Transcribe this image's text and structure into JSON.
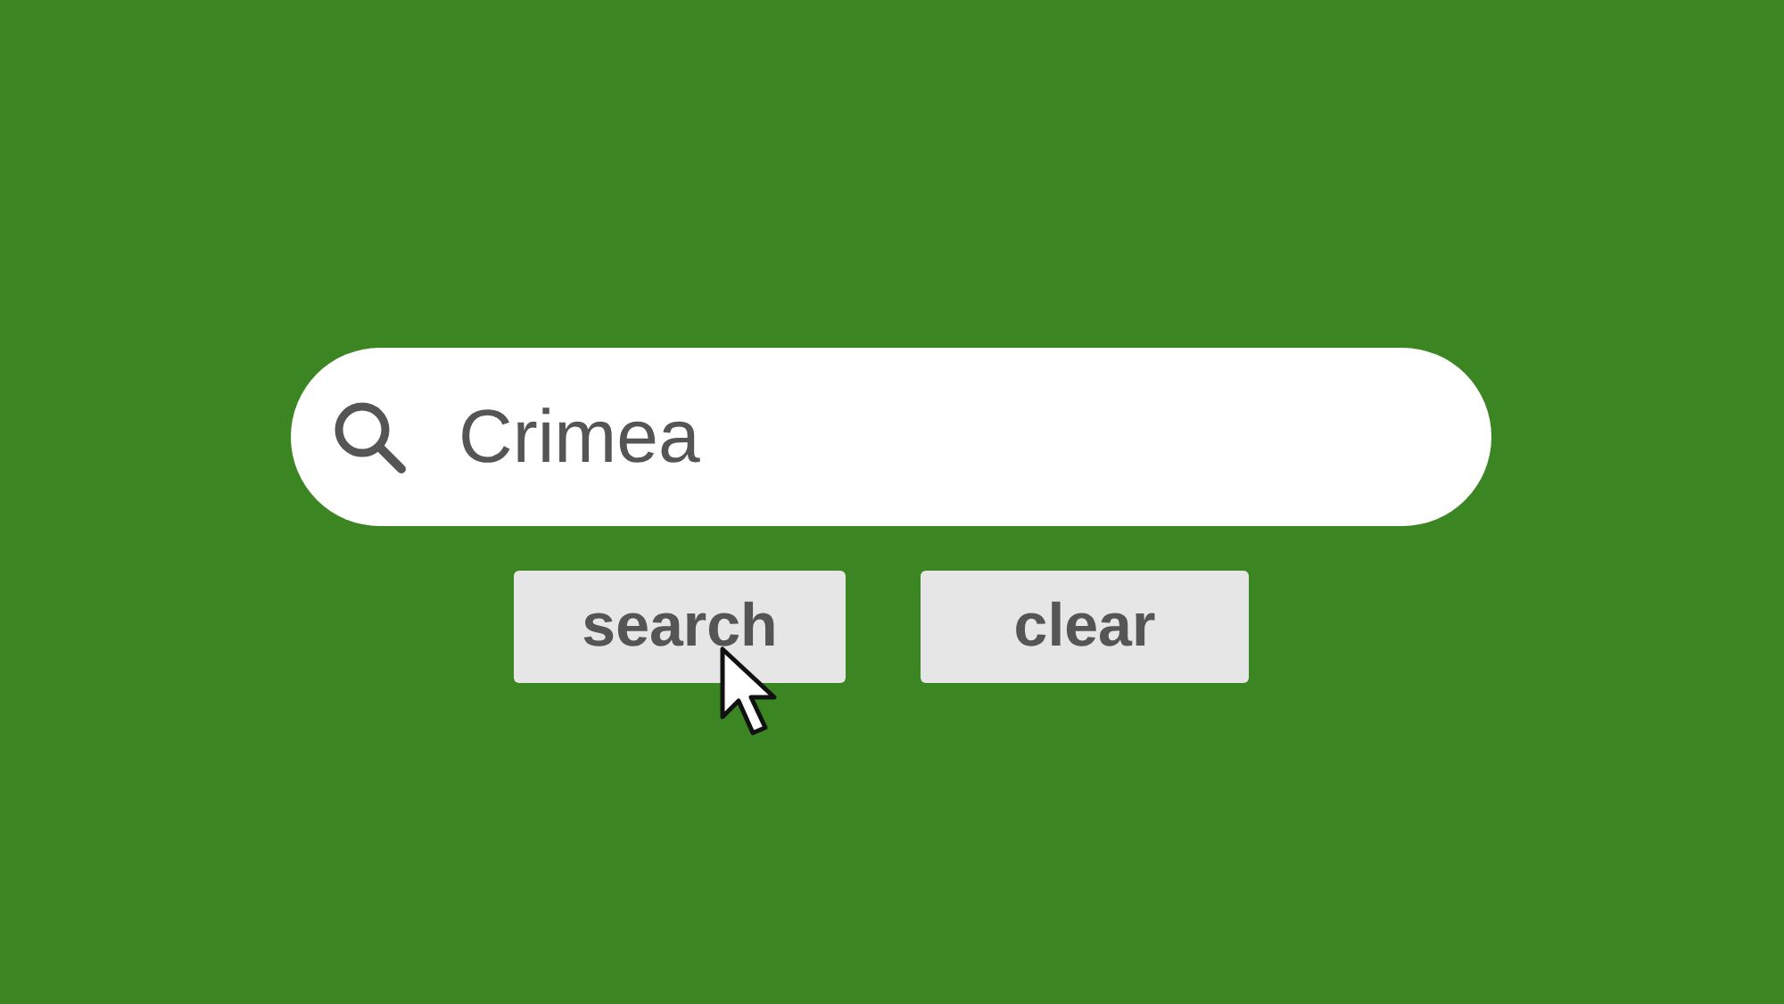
{
  "search": {
    "value": "Crimea"
  },
  "buttons": [
    {
      "label": "search",
      "hovered": true
    },
    {
      "label": "clear",
      "hovered": false
    }
  ]
}
